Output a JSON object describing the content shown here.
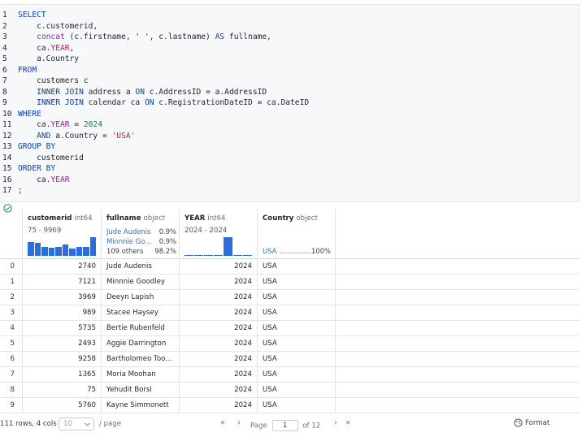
{
  "editor": {
    "lines": [
      {
        "n": "1",
        "parts": [
          [
            "kw",
            "SELECT"
          ]
        ]
      },
      {
        "n": "2",
        "parts": [
          [
            "pl",
            "    c.customerid,"
          ]
        ]
      },
      {
        "n": "3",
        "parts": [
          [
            "pl",
            "    "
          ],
          [
            "fn",
            "concat"
          ],
          [
            "pl",
            " (c.firstname, ' ', c.lastname) "
          ],
          [
            "kw",
            "AS"
          ],
          [
            "pl",
            " fullname,"
          ]
        ]
      },
      {
        "n": "4",
        "parts": [
          [
            "pl",
            "    ca."
          ],
          [
            "ky",
            "YEAR"
          ],
          [
            "pl",
            ","
          ]
        ]
      },
      {
        "n": "5",
        "parts": [
          [
            "pl",
            "    a.Country"
          ]
        ]
      },
      {
        "n": "6",
        "parts": [
          [
            "kw",
            "FROM"
          ]
        ]
      },
      {
        "n": "7",
        "parts": [
          [
            "pl",
            "    customers c"
          ]
        ]
      },
      {
        "n": "8",
        "parts": [
          [
            "pl",
            "    "
          ],
          [
            "kw",
            "INNER JOIN"
          ],
          [
            "pl",
            " address a "
          ],
          [
            "kw",
            "ON"
          ],
          [
            "pl",
            " c.AddressID = a.AddressID"
          ]
        ]
      },
      {
        "n": "9",
        "parts": [
          [
            "pl",
            "    "
          ],
          [
            "kw",
            "INNER JOIN"
          ],
          [
            "pl",
            " calendar ca "
          ],
          [
            "kw",
            "ON"
          ],
          [
            "pl",
            " c.RegistrationDateID = ca.DateID"
          ]
        ]
      },
      {
        "n": "10",
        "parts": [
          [
            "kw",
            "WHERE"
          ]
        ]
      },
      {
        "n": "11",
        "parts": [
          [
            "pl",
            "    ca."
          ],
          [
            "ky",
            "YEAR"
          ],
          [
            "pl",
            " = "
          ],
          [
            "nm",
            "2024"
          ]
        ]
      },
      {
        "n": "12",
        "parts": [
          [
            "pl",
            "    "
          ],
          [
            "kw",
            "AND"
          ],
          [
            "pl",
            " a.Country = "
          ],
          [
            "st",
            "'USA'"
          ]
        ]
      },
      {
        "n": "13",
        "parts": [
          [
            "kw",
            "GROUP BY"
          ]
        ]
      },
      {
        "n": "14",
        "parts": [
          [
            "pl",
            "    customerid"
          ]
        ]
      },
      {
        "n": "15",
        "parts": [
          [
            "kw",
            "ORDER BY"
          ]
        ]
      },
      {
        "n": "16",
        "parts": [
          [
            "pl",
            "    ca."
          ],
          [
            "ky",
            "YEAR"
          ]
        ]
      },
      {
        "n": "17",
        "parts": [
          [
            "pl",
            ";"
          ]
        ]
      }
    ]
  },
  "status_icon": "check-circle-icon",
  "table": {
    "columns": {
      "customerid": {
        "name": "customerid",
        "type": "int64",
        "range": "75 - 9969",
        "hist": [
          0.75,
          0.7,
          0.48,
          0.42,
          0.5,
          0.62,
          0.38,
          0.5,
          0.48,
          1.0
        ]
      },
      "fullname": {
        "name": "fullname",
        "type": "object",
        "top1_value": "Jude Audenis",
        "top1_pct": "0.9%",
        "top2_value": "Minnnie Goodley",
        "top2_pct": "0.9%",
        "others": "109 others",
        "others_pct": "98.2%"
      },
      "year": {
        "name": "YEAR",
        "type": "int64",
        "range": "2024 - 2024",
        "hist": [
          0,
          0,
          0,
          0,
          1.0,
          0,
          0
        ]
      },
      "country": {
        "name": "Country",
        "type": "object",
        "top_value": "USA",
        "top_pct": "100%"
      }
    },
    "rows": [
      {
        "idx": "0",
        "customerid": "2740",
        "fullname": "Jude Audenis",
        "year": "2024",
        "country": "USA"
      },
      {
        "idx": "1",
        "customerid": "7121",
        "fullname": "Minnnie Goodley",
        "year": "2024",
        "country": "USA"
      },
      {
        "idx": "2",
        "customerid": "3969",
        "fullname": "Deeyn Lapish",
        "year": "2024",
        "country": "USA"
      },
      {
        "idx": "3",
        "customerid": "989",
        "fullname": "Stacee Haysey",
        "year": "2024",
        "country": "USA"
      },
      {
        "idx": "4",
        "customerid": "5735",
        "fullname": "Bertie Rubenfeld",
        "year": "2024",
        "country": "USA"
      },
      {
        "idx": "5",
        "customerid": "2493",
        "fullname": "Aggie Darrington",
        "year": "2024",
        "country": "USA"
      },
      {
        "idx": "6",
        "customerid": "9258",
        "fullname": "Bartholomeo Too...",
        "year": "2024",
        "country": "USA"
      },
      {
        "idx": "7",
        "customerid": "1365",
        "fullname": "Moria Moohan",
        "year": "2024",
        "country": "USA"
      },
      {
        "idx": "8",
        "customerid": "75",
        "fullname": "Yehudit Borsi",
        "year": "2024",
        "country": "USA"
      },
      {
        "idx": "9",
        "customerid": "5760",
        "fullname": "Kayne Simmonett",
        "year": "2024",
        "country": "USA"
      }
    ]
  },
  "footer": {
    "rows_info": "111 rows, 4 cols",
    "page_size": "10",
    "per_page": "/ page",
    "first": "«",
    "prev": "‹",
    "next": "›",
    "last": "»",
    "page_label": "Page",
    "page_value": "1",
    "of_pages": "of 12",
    "format_label": "Format"
  }
}
